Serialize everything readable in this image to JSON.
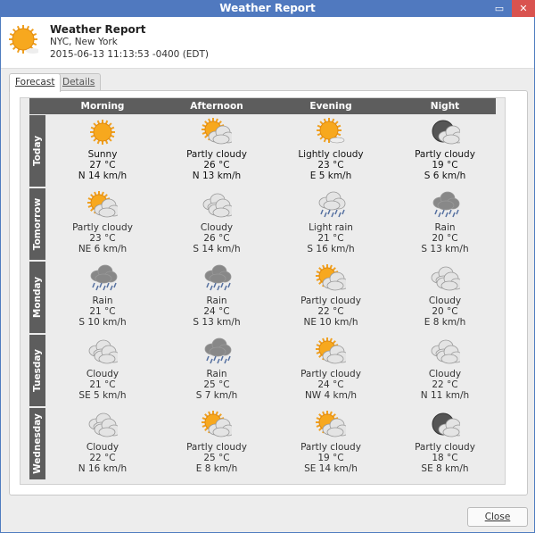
{
  "window": {
    "title": "Weather Report",
    "minimize_icon": "minimize-icon",
    "close_icon": "close-icon"
  },
  "header": {
    "title": "Weather Report",
    "location": "NYC, New York",
    "timestamp": "2015-06-13 11:13:53 -0400 (EDT)",
    "icon": "partly-sunny"
  },
  "tabs": [
    {
      "label": "Forecast",
      "active": true
    },
    {
      "label": "Details",
      "active": false
    }
  ],
  "columns": [
    "Morning",
    "Afternoon",
    "Evening",
    "Night"
  ],
  "days": [
    {
      "label": "Today",
      "cells": [
        {
          "icon": "sunny",
          "condition": "Sunny",
          "temp": "27 °C",
          "wind": "N 14 km/h"
        },
        {
          "icon": "partly-cloudy",
          "condition": "Partly cloudy",
          "temp": "26 °C",
          "wind": "N 13 km/h"
        },
        {
          "icon": "lightly-cloudy",
          "condition": "Lightly cloudy",
          "temp": "23 °C",
          "wind": "E 5 km/h"
        },
        {
          "icon": "partly-cloudy-night",
          "condition": "Partly cloudy",
          "temp": "19 °C",
          "wind": "S 6 km/h"
        }
      ]
    },
    {
      "label": "Tomorrow",
      "cells": [
        {
          "icon": "partly-cloudy",
          "condition": "Partly cloudy",
          "temp": "23 °C",
          "wind": "NE 6 km/h"
        },
        {
          "icon": "cloudy",
          "condition": "Cloudy",
          "temp": "26 °C",
          "wind": "S 14 km/h"
        },
        {
          "icon": "light-rain",
          "condition": "Light rain",
          "temp": "21 °C",
          "wind": "S 16 km/h"
        },
        {
          "icon": "rain",
          "condition": "Rain",
          "temp": "20 °C",
          "wind": "S 13 km/h"
        }
      ]
    },
    {
      "label": "Monday",
      "cells": [
        {
          "icon": "rain",
          "condition": "Rain",
          "temp": "21 °C",
          "wind": "S 10 km/h"
        },
        {
          "icon": "rain",
          "condition": "Rain",
          "temp": "24 °C",
          "wind": "S 13 km/h"
        },
        {
          "icon": "partly-cloudy",
          "condition": "Partly cloudy",
          "temp": "22 °C",
          "wind": "NE 10 km/h"
        },
        {
          "icon": "cloudy",
          "condition": "Cloudy",
          "temp": "20 °C",
          "wind": "E 8 km/h"
        }
      ]
    },
    {
      "label": "Tuesday",
      "cells": [
        {
          "icon": "cloudy",
          "condition": "Cloudy",
          "temp": "21 °C",
          "wind": "SE 5 km/h"
        },
        {
          "icon": "rain",
          "condition": "Rain",
          "temp": "25 °C",
          "wind": "S 7 km/h"
        },
        {
          "icon": "partly-cloudy",
          "condition": "Partly cloudy",
          "temp": "24 °C",
          "wind": "NW 4 km/h"
        },
        {
          "icon": "cloudy",
          "condition": "Cloudy",
          "temp": "22 °C",
          "wind": "N 11 km/h"
        }
      ]
    },
    {
      "label": "Wednesday",
      "cells": [
        {
          "icon": "cloudy",
          "condition": "Cloudy",
          "temp": "22 °C",
          "wind": "N 16 km/h"
        },
        {
          "icon": "partly-cloudy",
          "condition": "Partly cloudy",
          "temp": "25 °C",
          "wind": "E 8 km/h"
        },
        {
          "icon": "partly-cloudy",
          "condition": "Partly cloudy",
          "temp": "19 °C",
          "wind": "SE 14 km/h"
        },
        {
          "icon": "partly-cloudy-night",
          "condition": "Partly cloudy",
          "temp": "18 °C",
          "wind": "SE 8 km/h"
        }
      ]
    }
  ],
  "footer": {
    "close_label": "Close"
  },
  "colors": {
    "titlebar": "#5079bf",
    "close_button": "#d9534f",
    "header_bg": "#5d5d5d",
    "sun": "#f5a623"
  }
}
